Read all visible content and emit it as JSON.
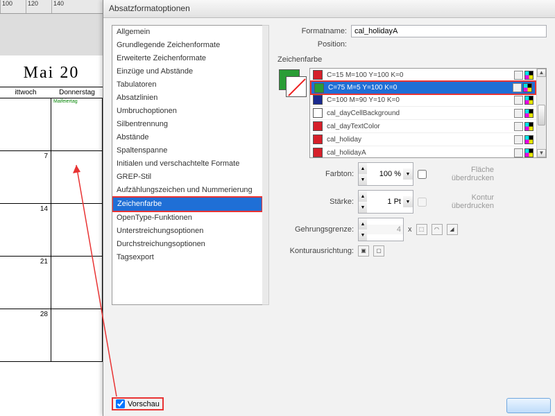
{
  "ruler": [
    "100",
    "120",
    "140"
  ],
  "calendar": {
    "month": "Mai 20",
    "col1": "ittwoch",
    "col2": "Donnerstag",
    "holiday_label": "Maifeiertag",
    "days": [
      "7",
      "14",
      "21",
      "28"
    ]
  },
  "dialog": {
    "title": "Absatzformatoptionen",
    "formatname_label": "Formatname:",
    "formatname_value": "cal_holidayA",
    "position_label": "Position:",
    "section_title": "Zeichenfarbe"
  },
  "categories": [
    "Allgemein",
    "Grundlegende Zeichenformate",
    "Erweiterte Zeichenformate",
    "Einzüge und Abstände",
    "Tabulatoren",
    "Absatzlinien",
    "Umbruchoptionen",
    "Silbentrennung",
    "Abstände",
    "Spaltenspanne",
    "Initialen und verschachtelte Formate",
    "GREP-Stil",
    "Aufzählungszeichen und Nummerierung",
    "Zeichenfarbe",
    "OpenType-Funktionen",
    "Unterstreichungsoptionen",
    "Durchstreichungsoptionen",
    "Tagsexport"
  ],
  "categories_selected_index": 13,
  "colors": [
    {
      "name": "C=15 M=100 Y=100 K=0",
      "hex": "#d6202a"
    },
    {
      "name": "C=75 M=5 Y=100 K=0",
      "hex": "#2a9d36"
    },
    {
      "name": "C=100 M=90 Y=10 K=0",
      "hex": "#1a2a8f"
    },
    {
      "name": "cal_dayCellBackground",
      "hex": "#ffffff"
    },
    {
      "name": "cal_dayTextColor",
      "hex": "#d6202a"
    },
    {
      "name": "cal_holiday",
      "hex": "#d6202a"
    },
    {
      "name": "cal_holidayA",
      "hex": "#d6202a"
    }
  ],
  "colors_selected_index": 1,
  "options": {
    "tint_label": "Farbton:",
    "tint_value": "100 %",
    "overprint_fill_label": "Fläche überdrucken",
    "weight_label": "Stärke:",
    "weight_value": "1 Pt",
    "overprint_stroke_label": "Kontur überdrucken",
    "miter_label": "Gehrungsgrenze:",
    "miter_value": "4",
    "miter_x": "x",
    "align_label": "Konturausrichtung:"
  },
  "preview_label": "Vorschau"
}
